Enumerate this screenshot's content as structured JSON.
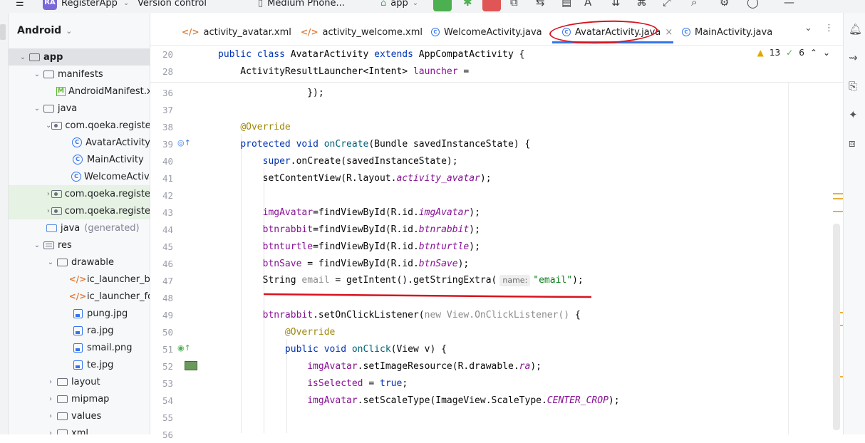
{
  "titlebar": {
    "app_badge": "RA",
    "project_name": "RegisterApp",
    "version_control": "Version control",
    "device": "Medium Phone...",
    "run_config": "app"
  },
  "project_panel": {
    "view_mode": "Android",
    "items": [
      {
        "label": "app",
        "type": "module"
      },
      {
        "label": "manifests",
        "type": "folder"
      },
      {
        "label": "AndroidManifest.xml",
        "type": "manifest"
      },
      {
        "label": "java",
        "type": "folder"
      },
      {
        "label": "com.qoeka.registe",
        "type": "package"
      },
      {
        "label": "AvatarActivity",
        "type": "class"
      },
      {
        "label": "MainActivity",
        "type": "class"
      },
      {
        "label": "WelcomeActivit",
        "type": "class"
      },
      {
        "label": "com.qoeka.registe",
        "type": "package"
      },
      {
        "label": "com.qoeka.registe",
        "type": "package"
      },
      {
        "label": "java",
        "suffix": "(generated)",
        "type": "folder"
      },
      {
        "label": "res",
        "type": "folder"
      },
      {
        "label": "drawable",
        "type": "folder"
      },
      {
        "label": "ic_launcher_ba",
        "type": "xml"
      },
      {
        "label": "ic_launcher_for",
        "type": "xml"
      },
      {
        "label": "pung.jpg",
        "type": "image"
      },
      {
        "label": "ra.jpg",
        "type": "image"
      },
      {
        "label": "smail.png",
        "type": "image"
      },
      {
        "label": "te.jpg",
        "type": "image"
      },
      {
        "label": "layout",
        "type": "folder"
      },
      {
        "label": "mipmap",
        "type": "folder"
      },
      {
        "label": "values",
        "type": "folder"
      },
      {
        "label": "xml",
        "type": "folder"
      }
    ]
  },
  "tabs": [
    {
      "label": "activity_avatar.xml",
      "kind": "xml"
    },
    {
      "label": "activity_welcome.xml",
      "kind": "xml"
    },
    {
      "label": "WelcomeActivity.java",
      "kind": "class"
    },
    {
      "label": "AvatarActivity.java",
      "kind": "class",
      "active": true
    },
    {
      "label": "MainActivity.java",
      "kind": "class"
    }
  ],
  "inspections": {
    "warnings": "13",
    "weak_warnings": "6"
  },
  "sticky_lines": [
    {
      "num": "20",
      "text": "public class AvatarActivity extends AppCompatActivity {"
    },
    {
      "num": "28",
      "text": "ActivityResultLauncher<Intent> launcher ="
    }
  ],
  "code_lines": {
    "l36": "36",
    "l37": "37",
    "l38": "38",
    "l39": "39",
    "l40": "40",
    "l41": "41",
    "l42": "42",
    "l43": "43",
    "l44": "44",
    "l45": "45",
    "l46": "46",
    "l47": "47",
    "l48": "48",
    "l49": "49",
    "l50": "50",
    "l51": "51",
    "l52": "52",
    "l53": "53",
    "l54": "54",
    "l55": "55",
    "l56": "56"
  },
  "code": {
    "c36": "});",
    "c38": "@Override",
    "c39_a": "protected",
    "c39_b": "void",
    "c39_c": "onCreate",
    "c39_d": "(Bundle savedInstanceState) {",
    "c40_a": "super",
    "c40_b": ".onCreate(savedInstanceState);",
    "c41_a": "setContentView(R.layout.",
    "c41_b": "activity_avatar",
    "c41_c": ");",
    "c43_a": "imgAvatar",
    "c43_b": "=findViewById(R.id.",
    "c43_c": "imgAvatar",
    "c43_d": ");",
    "c44_a": "btnrabbit",
    "c44_b": "=findViewById(R.id.",
    "c44_c": "btnrabbit",
    "c44_d": ");",
    "c45_a": "btnturtle",
    "c45_b": "=findViewById(R.id.",
    "c45_c": "btnturtle",
    "c45_d": ");",
    "c46_a": "btnSave",
    "c46_b": " = findViewById(R.id.",
    "c46_c": "btnSave",
    "c46_d": ");",
    "c47_a": "String ",
    "c47_b": "email",
    "c47_c": " = getIntent().getStringExtra(",
    "c47_hint": "name:",
    "c47_d": "\"email\"",
    "c47_e": ");",
    "c49_a": "btnrabbit",
    "c49_b": ".setOnClickListener(",
    "c49_c": "new View.OnClickListener()",
    "c49_d": " {",
    "c50": "@Override",
    "c51_a": "public",
    "c51_b": "void",
    "c51_c": "onClick",
    "c51_d": "(View v) {",
    "c52_a": "imgAvatar",
    "c52_b": ".setImageResource(R.drawable.",
    "c52_c": "ra",
    "c52_d": ");",
    "c53_a": "isSelected",
    "c53_b": " = ",
    "c53_c": "true",
    "c53_d": ";",
    "c54_a": "imgAvatar",
    "c54_b": ".setScaleType(ImageView.ScaleType.",
    "c54_c": "CENTER_CROP",
    "c54_d": ");"
  },
  "colors": {
    "accent": "#3574f0",
    "annotation_red": "#d9131d",
    "keyword": "#0033b3",
    "field": "#871094",
    "string": "#067d17"
  }
}
